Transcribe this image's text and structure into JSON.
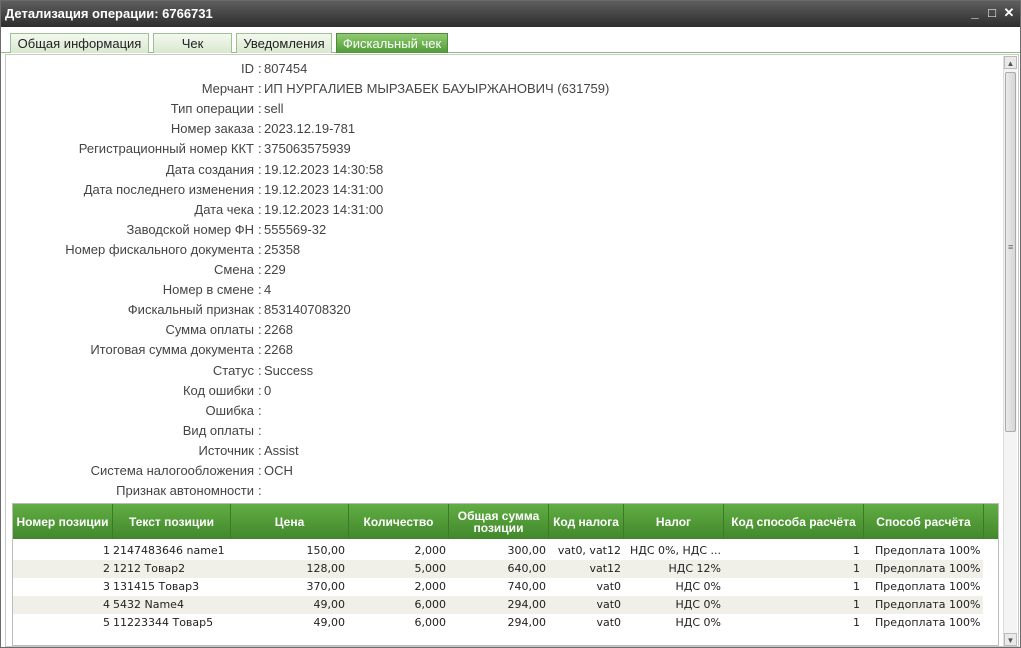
{
  "window": {
    "title": "Детализация операции: 6766731",
    "controls": {
      "minimize": "_",
      "maximize": "□",
      "close": "✕"
    }
  },
  "tabs": [
    {
      "label": "Общая информация",
      "active": false
    },
    {
      "label": "Чек",
      "active": false
    },
    {
      "label": "Уведомления",
      "active": false
    },
    {
      "label": "Фискальный чек",
      "active": true
    }
  ],
  "fields": [
    {
      "label": "ID",
      "value": "807454"
    },
    {
      "label": "Мерчант",
      "value": "ИП НУРГАЛИЕВ МЫРЗАБЕК БАУЫРЖАНОВИЧ (631759)"
    },
    {
      "label": "Тип операции",
      "value": "sell"
    },
    {
      "label": "Номер заказа",
      "value": "2023.12.19-781"
    },
    {
      "label": "Регистрационный номер ККТ",
      "value": "375063575939"
    },
    {
      "label": "Дата создания",
      "value": "19.12.2023 14:30:58"
    },
    {
      "label": "Дата последнего изменения",
      "value": "19.12.2023 14:31:00"
    },
    {
      "label": "Дата чека",
      "value": "19.12.2023 14:31:00"
    },
    {
      "label": "Заводской номер ФН",
      "value": "555569-32"
    },
    {
      "label": "Номер фискального документа",
      "value": "25358"
    },
    {
      "label": "Смена",
      "value": "229"
    },
    {
      "label": "Номер в смене",
      "value": "4"
    },
    {
      "label": "Фискальный признак",
      "value": "853140708320"
    },
    {
      "label": "Сумма оплаты",
      "value": "2268"
    },
    {
      "label": "Итоговая сумма документа",
      "value": "2268"
    },
    {
      "label": "Статус",
      "value": "Success"
    },
    {
      "label": "Код ошибки",
      "value": "0"
    },
    {
      "label": "Ошибка",
      "value": ""
    },
    {
      "label": "Вид оплаты",
      "value": ""
    },
    {
      "label": "Источник",
      "value": "Assist"
    },
    {
      "label": "Система налогообложения",
      "value": "ОСН"
    },
    {
      "label": "Признак автономности",
      "value": ""
    }
  ],
  "separator": ":",
  "table": {
    "columns": [
      "Номер позиции",
      "Текст позиции",
      "Цена",
      "Количество",
      "Общая сумма позиции",
      "Код налога",
      "Налог",
      "Код способа расчёта",
      "Способ расчёта"
    ],
    "rows": [
      [
        "1",
        "2147483646 name1",
        "150,00",
        "2,000",
        "300,00",
        "vat0, vat12",
        "НДС 0%, НДС ...",
        "1",
        "Предоплата 100%"
      ],
      [
        "2",
        "1212 Товар2",
        "128,00",
        "5,000",
        "640,00",
        "vat12",
        "НДС 12%",
        "1",
        "Предоплата 100%"
      ],
      [
        "3",
        "131415 Товар3",
        "370,00",
        "2,000",
        "740,00",
        "vat0",
        "НДС 0%",
        "1",
        "Предоплата 100%"
      ],
      [
        "4",
        "5432 Name4",
        "49,00",
        "6,000",
        "294,00",
        "vat0",
        "НДС 0%",
        "1",
        "Предоплата 100%"
      ],
      [
        "5",
        "11223344 Товар5",
        "49,00",
        "6,000",
        "294,00",
        "vat0",
        "НДС 0%",
        "1",
        "Предоплата 100%"
      ]
    ]
  },
  "colors": {
    "titlebar": "#3d3d3d",
    "tab_active": "#5aa83f",
    "grid_header": "#4f9a36",
    "row_alt": "#f0efe8"
  },
  "icons": {
    "scroll_up": "scroll-up-icon",
    "scroll_down": "scroll-down-icon"
  }
}
